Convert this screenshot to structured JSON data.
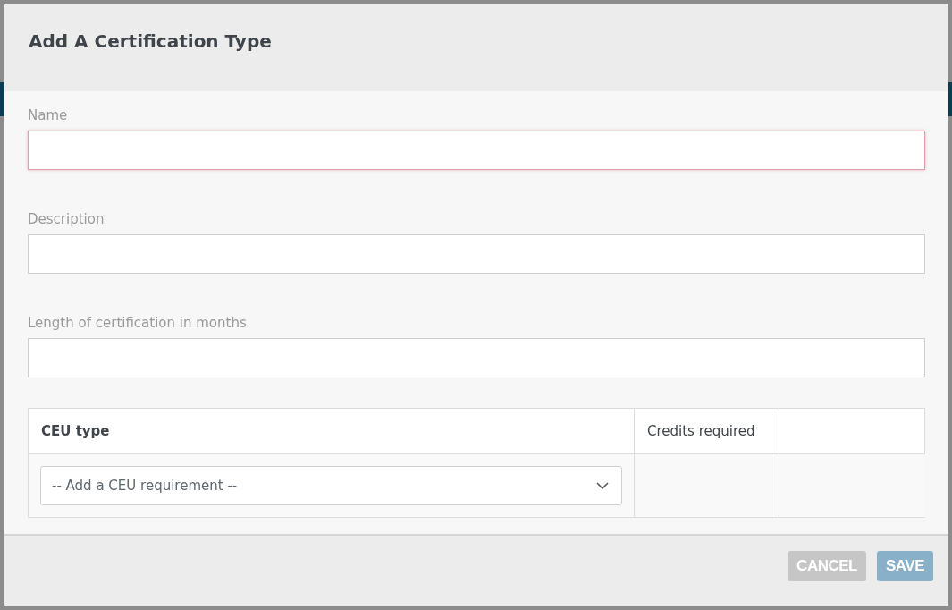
{
  "dialog": {
    "title": "Add A Certification Type",
    "fields": [
      {
        "label": "Name",
        "invalid": true
      },
      {
        "label": "Description",
        "invalid": false
      },
      {
        "label": "Length of certification in months",
        "invalid": false
      }
    ],
    "table": {
      "columns": [
        "CEU type",
        "Credits required"
      ],
      "rows": [
        {
          "select_placeholder": "-- Add a CEU requirement --"
        }
      ]
    },
    "buttons": [
      {
        "label": "CANCEL",
        "kind": "secondary",
        "disabled": true
      },
      {
        "label": "SAVE",
        "kind": "primary",
        "disabled": true
      }
    ]
  }
}
